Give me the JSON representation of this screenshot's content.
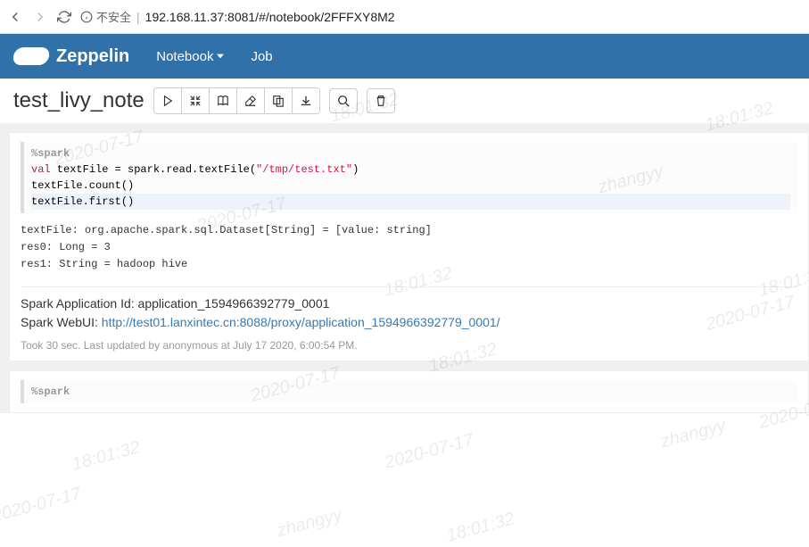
{
  "browser": {
    "insecure_label": "不安全",
    "url": "192.168.11.37:8081/#/notebook/2FFFXY8M2"
  },
  "nav": {
    "brand": "Zeppelin",
    "notebook": "Notebook",
    "job": "Job"
  },
  "note": {
    "title": "test_livy_note"
  },
  "para1": {
    "directive": "%spark",
    "code_l1_kw": "val",
    "code_l1_rest": " textFile = spark.read.textFile(",
    "code_l1_str": "\"/tmp/test.txt\"",
    "code_l1_end": ")",
    "code_l2": "textFile.count()",
    "code_l3": "textFile.first()",
    "out_l1": "textFile: org.apache.spark.sql.Dataset[String] = [value: string]",
    "out_l2": "res0: Long = 3",
    "out_l3": "res1: String = hadoop hive",
    "appid_label": "Spark Application Id: ",
    "appid": "application_1594966392779_0001",
    "webui_label": "Spark WebUI: ",
    "webui_link": "http://test01.lanxintec.cn:8088/proxy/application_1594966392779_0001/",
    "exec": "Took 30 sec. Last updated by anonymous at July 17 2020, 6:00:54 PM."
  },
  "para2": {
    "directive": "%spark"
  },
  "watermark": {
    "date": "2020-07-17",
    "time": "18:01:32",
    "user": "zhangyy"
  }
}
